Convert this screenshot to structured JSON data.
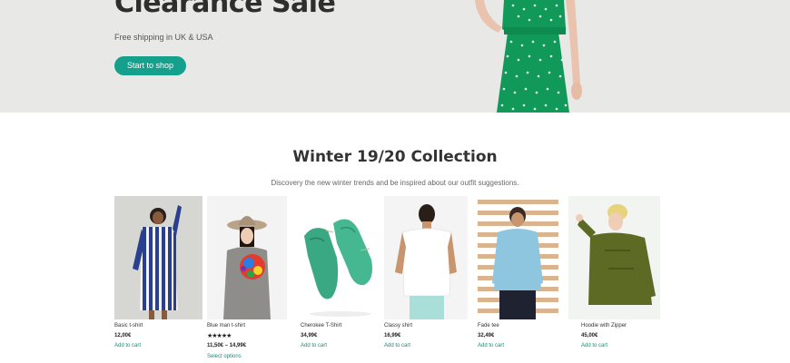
{
  "hero": {
    "title": "Clearance Sale",
    "subtitle": "Free shipping in UK & USA",
    "cta_label": "Start to shop"
  },
  "collection": {
    "title": "Winter 19/20 Collection",
    "subtitle": "Discovery the new winter trends and be inspired about our outfit suggestions."
  },
  "products": [
    {
      "name": "Basic t-shirt",
      "price": "12,00€",
      "action": "Add to cart"
    },
    {
      "name": "Blue man t-shirt",
      "stars": "★★★★★",
      "price": "11,50€ – 14,99€",
      "action": "Select options"
    },
    {
      "name": "Cherokee T-Shirt",
      "price": "34,99€",
      "action": "Add to cart"
    },
    {
      "name": "Classy shirt",
      "price": "16,99€",
      "action": "Add to cart"
    },
    {
      "name": "Fade tee",
      "price": "32,49€",
      "action": "Add to cart"
    },
    {
      "name": "Hoodie with Zipper",
      "price": "45,00€",
      "action": "Add to cart"
    }
  ],
  "colors": {
    "accent": "#14a08c",
    "hero_bg": "#e8e8e6"
  }
}
